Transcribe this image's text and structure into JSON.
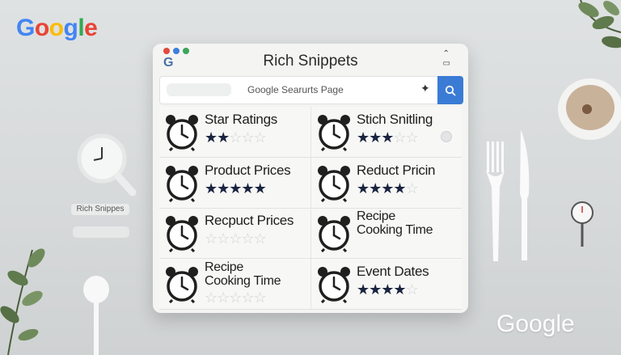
{
  "brand": {
    "top_logo": [
      "G",
      "o",
      "o",
      "g",
      "l",
      "e"
    ],
    "bottom_logo": "Google"
  },
  "side": {
    "chip_label": "Rich Snippes"
  },
  "window": {
    "title": "Rich Snippets",
    "browser_logo": "G",
    "search": {
      "value": "Google Searurts Page"
    },
    "colors": {
      "accent": "#3a7bd5",
      "star_filled": "#1a2440",
      "star_empty": "#cfd2d6"
    }
  },
  "rows": [
    {
      "left": {
        "label": "Star Ratings",
        "label2": "",
        "rating": 2
      },
      "right": {
        "label": "Stich Snitling",
        "label2": "",
        "rating": 3
      }
    },
    {
      "left": {
        "label": "Product Prices",
        "label2": "",
        "rating": 5
      },
      "right": {
        "label": "Reduct Pricin",
        "label2": "",
        "rating": 4
      }
    },
    {
      "left": {
        "label": "Recpuct Prices",
        "label2": "",
        "rating": 0
      },
      "right": {
        "label": "Recipe",
        "label2": "Cooking Time",
        "rating": null
      }
    },
    {
      "left": {
        "label": "Recipe",
        "label2": "Cooking Time",
        "rating": 0
      },
      "right": {
        "label": "Event Dates",
        "label2": "",
        "rating": 4
      }
    }
  ]
}
